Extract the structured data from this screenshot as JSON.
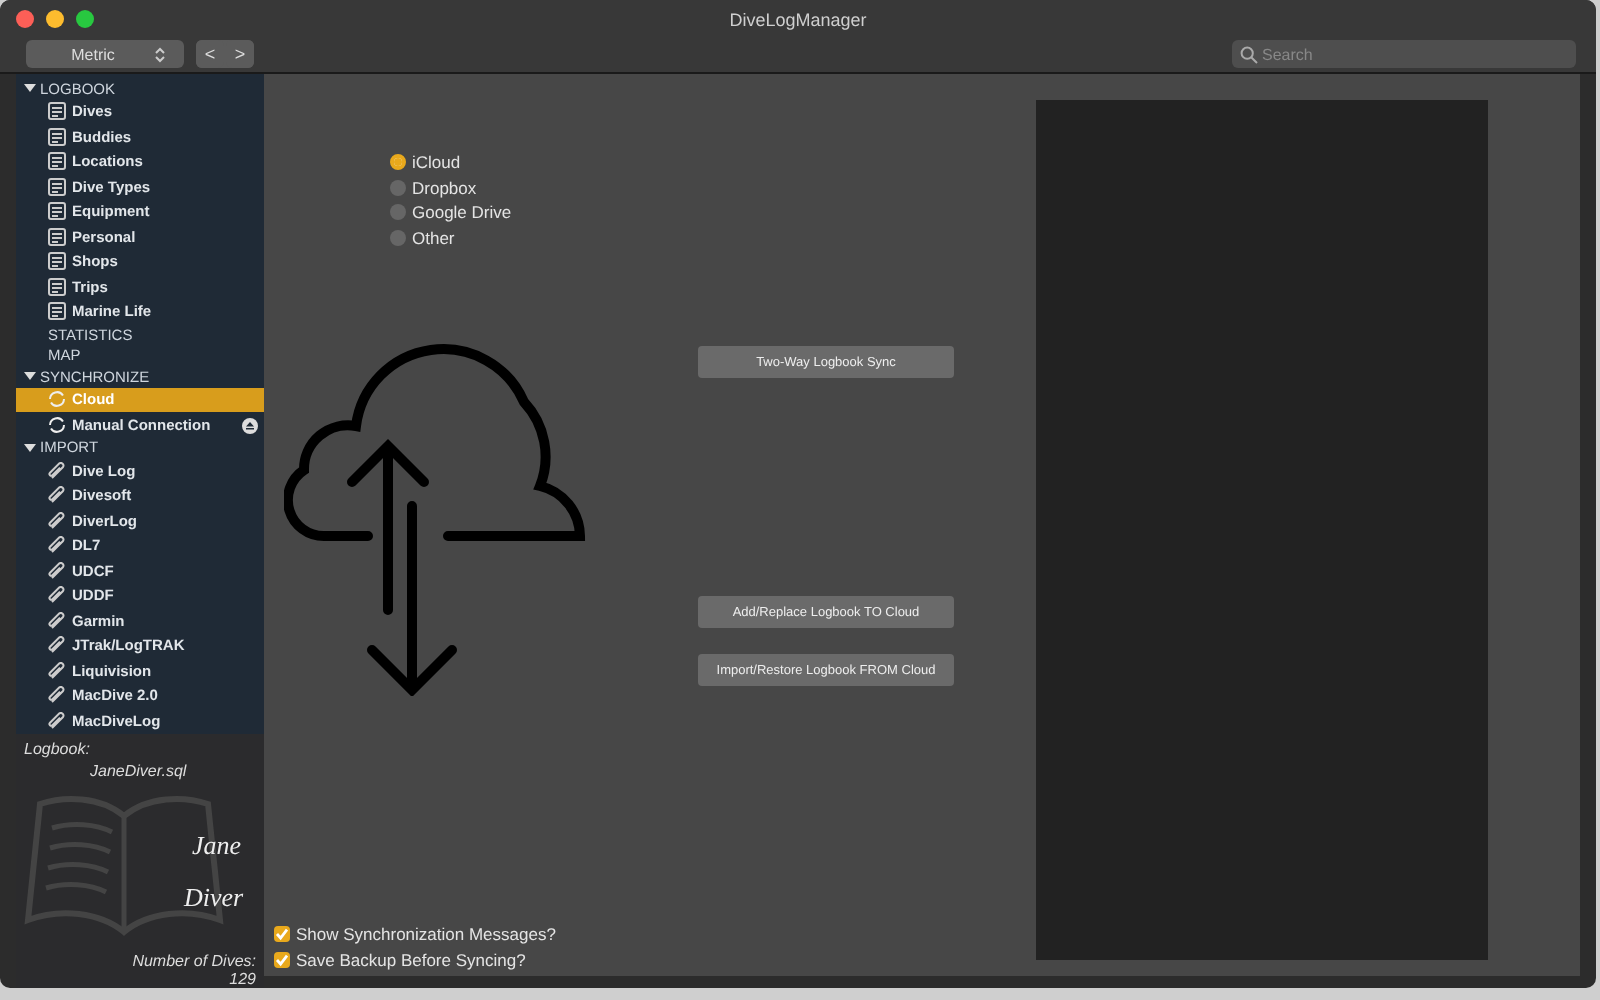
{
  "window": {
    "title": "DiveLogManager"
  },
  "toolbar": {
    "units": "Metric",
    "back": "<",
    "forward": ">",
    "search": {
      "placeholder": "Search"
    }
  },
  "sidebar": {
    "sections": [
      {
        "label": "LOGBOOK",
        "expanded": true,
        "kind": "logbook",
        "children": [
          {
            "label": "Dives",
            "selected": false
          },
          {
            "label": "Buddies",
            "selected": false
          },
          {
            "label": "Locations",
            "selected": false
          },
          {
            "label": "Dive Types",
            "selected": false
          },
          {
            "label": "Equipment",
            "selected": false
          },
          {
            "label": "Personal",
            "selected": false
          },
          {
            "label": "Shops",
            "selected": false
          },
          {
            "label": "Trips",
            "selected": false
          },
          {
            "label": "Marine Life",
            "selected": false
          }
        ]
      },
      {
        "label": "STATISTICS",
        "kind": "plain"
      },
      {
        "label": "MAP",
        "kind": "plain"
      },
      {
        "label": "SYNCHRONIZE",
        "expanded": true,
        "kind": "sync",
        "children": [
          {
            "label": "Cloud",
            "selected": true
          },
          {
            "label": "Manual Connection",
            "selected": false,
            "eject": true
          }
        ]
      },
      {
        "label": "IMPORT",
        "expanded": true,
        "kind": "import",
        "children": [
          {
            "label": "Dive Log",
            "selected": false
          },
          {
            "label": "Divesoft",
            "selected": false
          },
          {
            "label": "DiverLog",
            "selected": false
          },
          {
            "label": "DL7",
            "selected": false
          },
          {
            "label": "UDCF",
            "selected": false
          },
          {
            "label": "UDDF",
            "selected": false
          },
          {
            "label": "Garmin",
            "selected": false
          },
          {
            "label": "JTrak/LogTRAK",
            "selected": false
          },
          {
            "label": "Liquivision",
            "selected": false
          },
          {
            "label": "MacDive 2.0",
            "selected": false
          },
          {
            "label": "MacDiveLog",
            "selected": false
          }
        ]
      }
    ]
  },
  "logbook_info": {
    "label": "Logbook:",
    "file": "JaneDiver.sql",
    "cover_lines": [
      "Jane",
      "Diver"
    ],
    "dives_label": "Number of Dives:",
    "dives_count": "129"
  },
  "cloud_options": [
    {
      "label": "iCloud",
      "selected": true
    },
    {
      "label": "Dropbox",
      "selected": false
    },
    {
      "label": "Google Drive",
      "selected": false
    },
    {
      "label": "Other",
      "selected": false
    }
  ],
  "buttons": [
    "Two-Way Logbook Sync",
    "Add/Replace Logbook TO Cloud",
    "Import/Restore Logbook FROM Cloud"
  ],
  "options": [
    {
      "label": "Show Synchronization Messages?",
      "checked": true
    },
    {
      "label": "Save Backup Before Syncing?",
      "checked": true
    }
  ]
}
